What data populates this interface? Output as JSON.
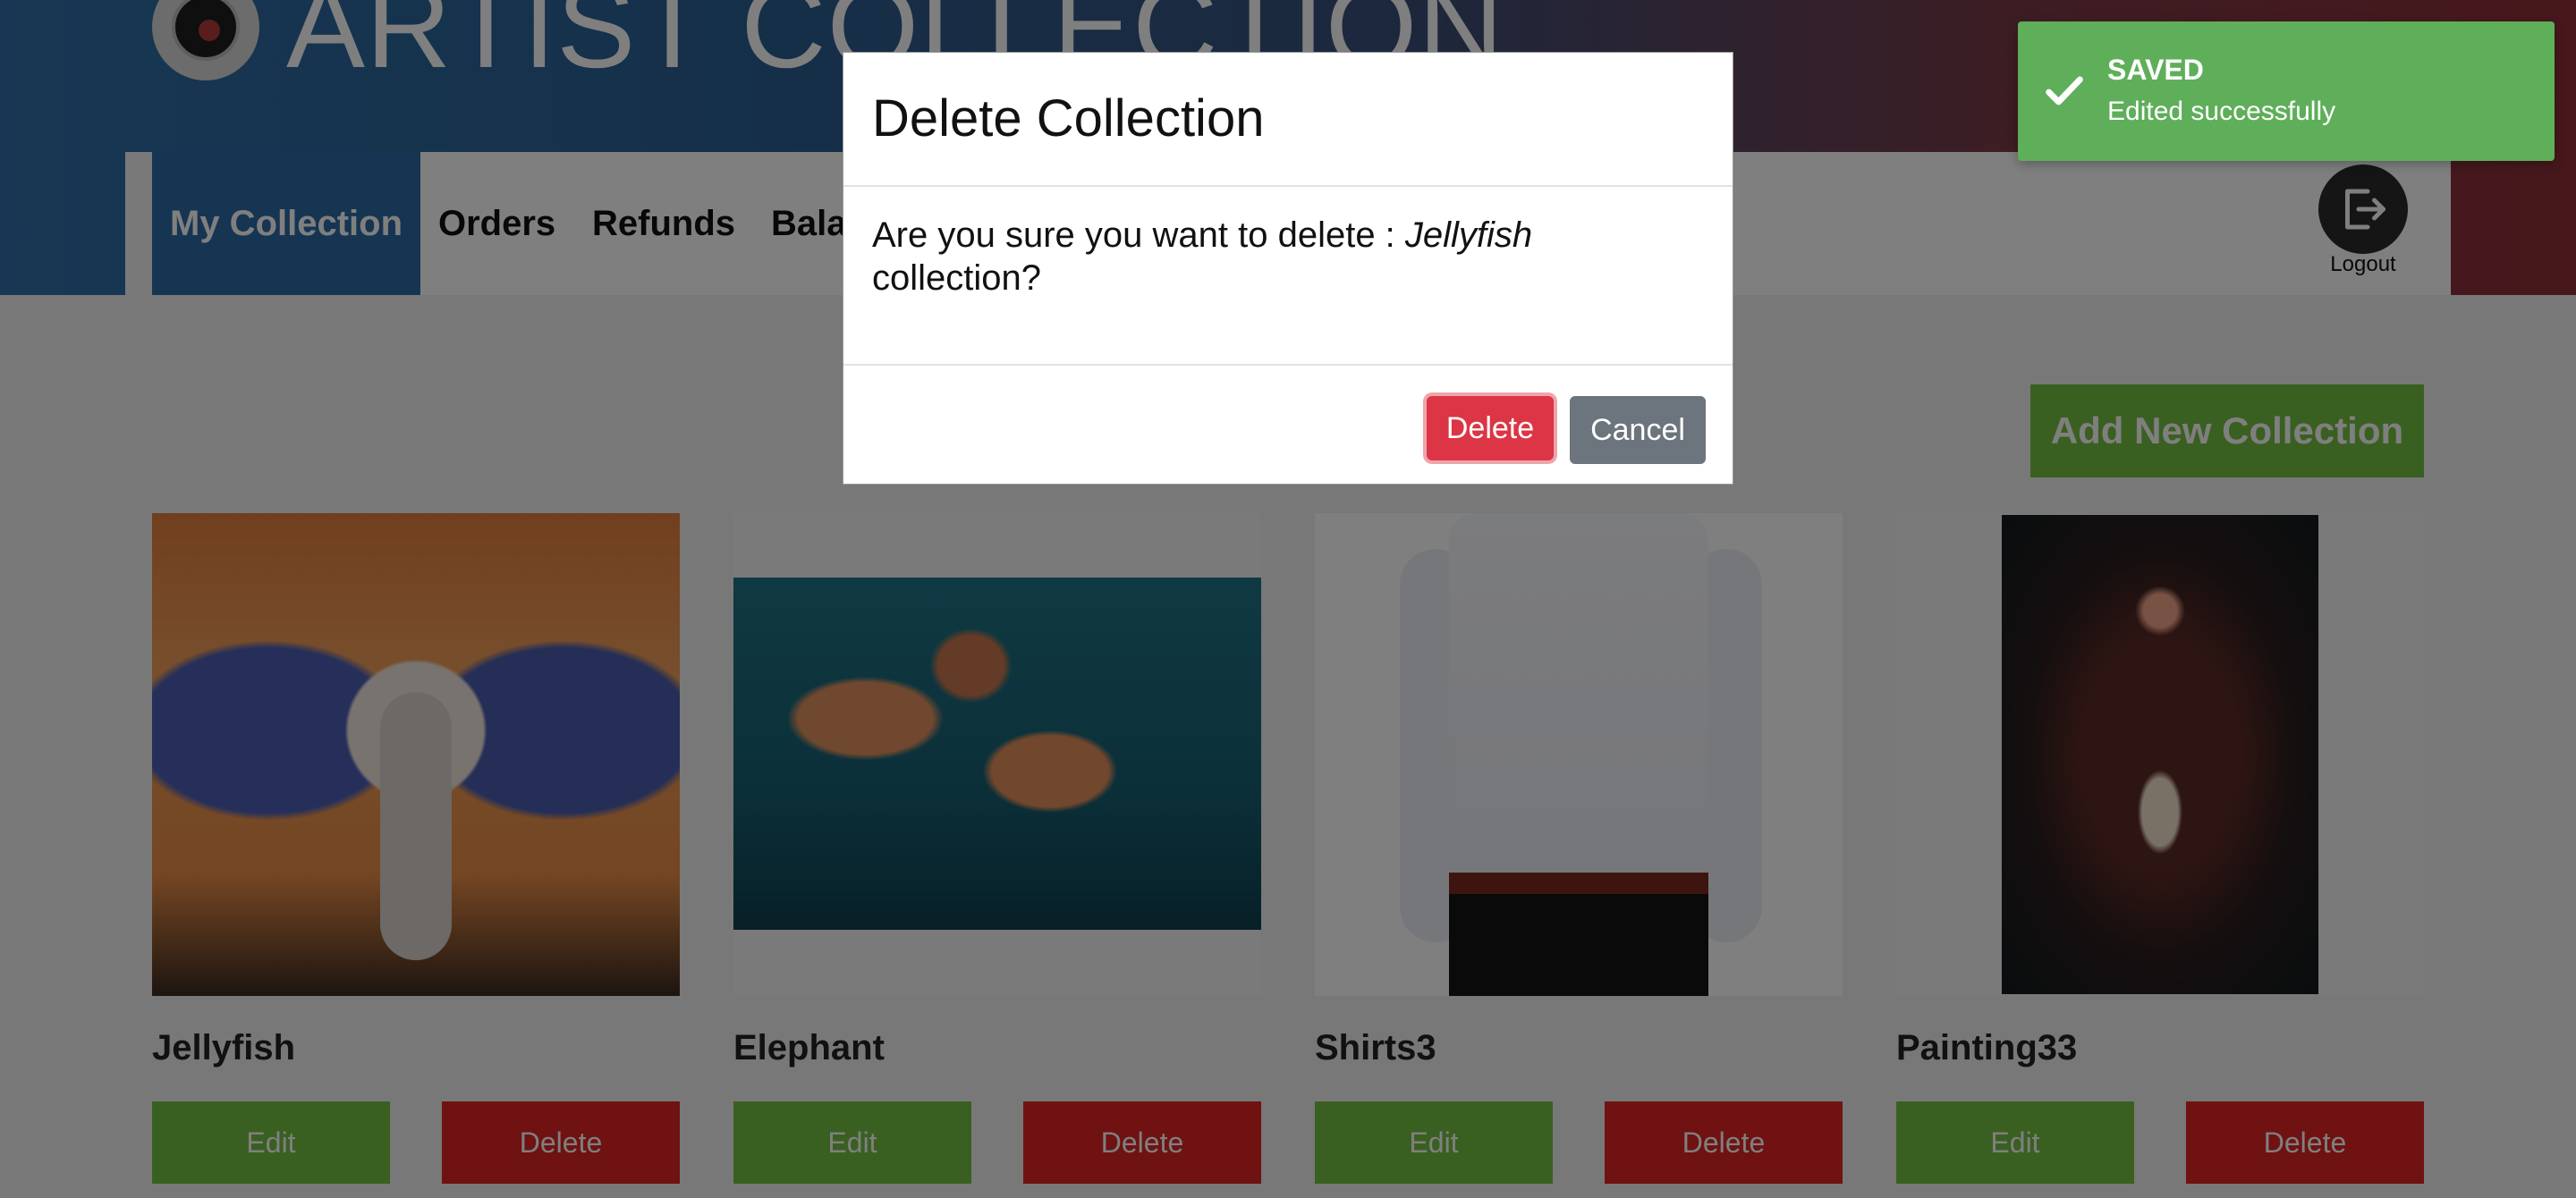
{
  "brand": {
    "title": "ARTIST COLLECTION"
  },
  "nav": {
    "items": [
      {
        "label": "My Collection"
      },
      {
        "label": "Orders"
      },
      {
        "label": "Refunds"
      },
      {
        "label": "Bala"
      }
    ],
    "logout_label": "Logout"
  },
  "content": {
    "add_button": "Add New Collection",
    "cards": [
      {
        "title": "Jellyfish",
        "edit": "Edit",
        "delete": "Delete"
      },
      {
        "title": "Elephant",
        "edit": "Edit",
        "delete": "Delete"
      },
      {
        "title": "Shirts3",
        "edit": "Edit",
        "delete": "Delete"
      },
      {
        "title": "Painting33",
        "edit": "Edit",
        "delete": "Delete"
      }
    ]
  },
  "modal": {
    "title": "Delete Collection",
    "message_prefix": "Are you sure you want to delete : ",
    "message_name": "Jellyfish",
    "message_suffix": " collection?",
    "delete_label": "Delete",
    "cancel_label": "Cancel"
  },
  "toast": {
    "title": "SAVED",
    "message": "Edited successfully",
    "icon": "check-icon"
  },
  "colors": {
    "accent_green": "#74c043",
    "danger_red": "#e02424",
    "nav_active": "#2c6aa5",
    "toast_green": "#5fae5a",
    "modal_delete": "#dc3545",
    "modal_cancel": "#6c757d"
  }
}
